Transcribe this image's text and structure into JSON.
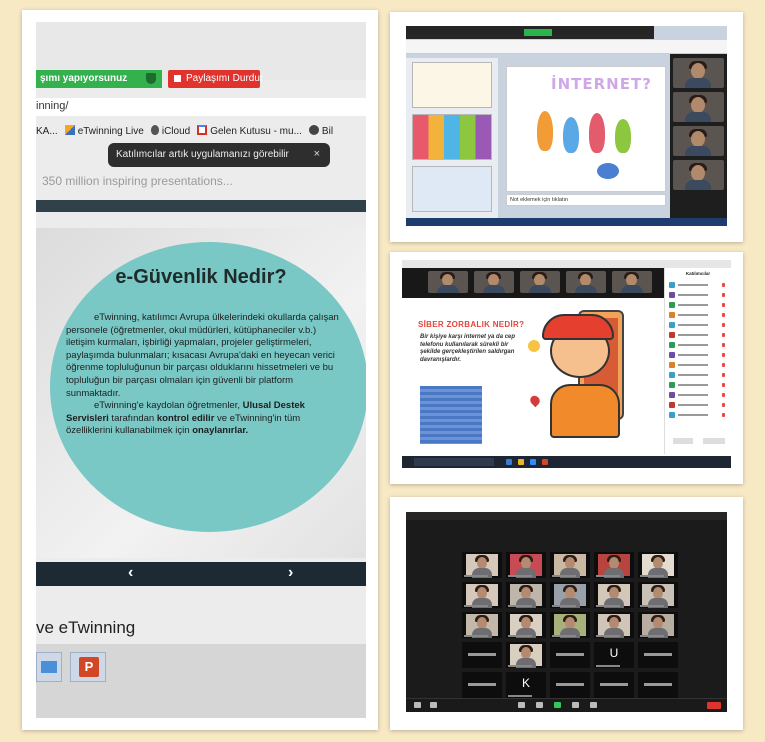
{
  "main_screenshot": {
    "sharing_banner": {
      "sharing_text": "şımı yapıyorsunuz",
      "stop_button": "Paylaşımı Durdur"
    },
    "url": "inning/",
    "bookmarks": [
      {
        "label": "KA...",
        "icon": "bookmark-icon"
      },
      {
        "label": "eTwinning Live",
        "icon": "etwinning-icon"
      },
      {
        "label": "iCloud",
        "icon": "apple-icon"
      },
      {
        "label": "Gelen Kutusu - mu...",
        "icon": "gmail-icon"
      },
      {
        "label": "Bil",
        "icon": "globe-icon"
      }
    ],
    "toast": {
      "message": "Katılımcılar artık uygulamanızı görebilir",
      "close": "×"
    },
    "tagline": "350 million inspiring presentations...",
    "slide": {
      "title": "e-Güvenlik Nedir?",
      "paragraph1": "eTwinning, katılımcı Avrupa ülkelerindeki okullarda çalışan personele (öğretmenler, okul müdürleri, kütüphaneciler v.b.) iletişim kurmaları, işbirliği yapmaları, projeler geliştirmeleri, paylaşımda bulunmaları; kısacası Avrupa'daki en heyecan verici öğrenme topluluğunun bir parçası olduklarını hissetmeleri ve bu topluluğun bir parçası olmaları için güvenli bir platform sunmaktadır.",
      "p2_part1": "eTwinning'e kaydolan öğretmenler, ",
      "p2_bold1": "Ulusal Destek Servisleri",
      "p2_part2": " tarafından ",
      "p2_bold2": "kontrol edilir",
      "p2_part3": " ve eTwinning'in tüm özelliklerini kullanabilmek için ",
      "p2_bold3": "onaylanırlar."
    },
    "nav": {
      "prev": "‹",
      "next": "›"
    },
    "window_title": "ve eTwinning",
    "taskbar_app": "P"
  },
  "top_right": {
    "slide_word": "İNTERNET?",
    "notes_placeholder": "Not eklemek için tıklatın"
  },
  "middle_right": {
    "slide_title": "SİBER ZORBALIK NEDİR?",
    "slide_text": "Bir kişiye karşı internet ya da cep telefonu kullanılarak sürekli bir şekilde gerçekleştirilen saldırgan davranışlardır.",
    "panel_title": "Katılımcılar"
  },
  "bottom_right": {
    "letter_tiles": [
      {
        "letter": "U",
        "color": "#6b4a3a"
      },
      {
        "letter": "K",
        "color": "#e07a1f"
      }
    ]
  },
  "colors": {
    "background": "#f7e9c4",
    "slide_circle": "#79c8c6",
    "share_green": "#33b14d",
    "share_red": "#e0332e",
    "slide_nav": "#1d2933"
  }
}
